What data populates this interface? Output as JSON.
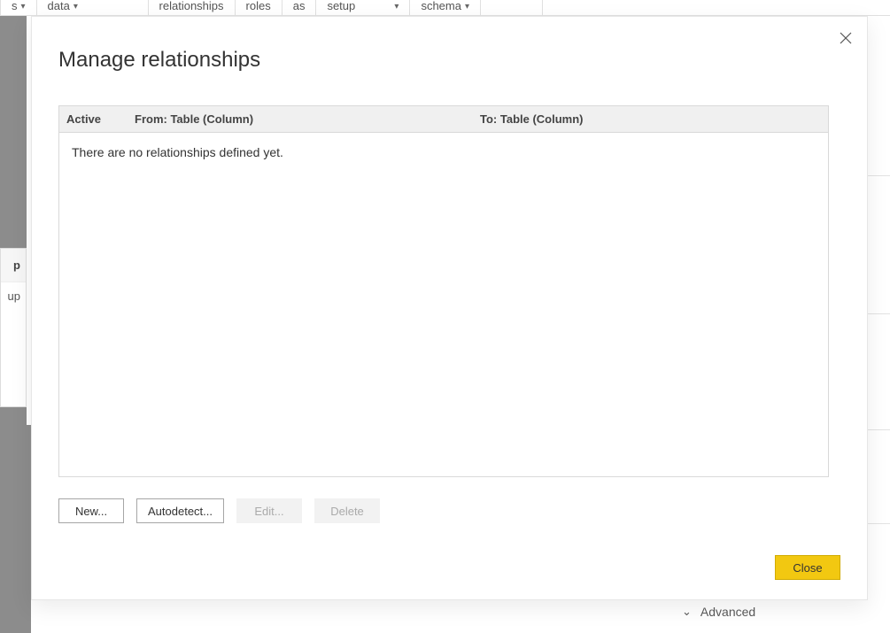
{
  "ribbon": {
    "items": [
      {
        "label": "s",
        "chev": true
      },
      {
        "label": "data",
        "chev": true
      },
      {
        "label": "relationships",
        "chev": false
      },
      {
        "label": "roles",
        "chev": false
      },
      {
        "label": "as",
        "chev": false
      },
      {
        "label": "setup",
        "chev": true,
        "wide": true
      },
      {
        "label": "schema",
        "chev": true
      }
    ]
  },
  "side": {
    "header": "p",
    "row": "up"
  },
  "background": {
    "advanced_label": "Advanced"
  },
  "dialog": {
    "title": "Manage relationships",
    "table": {
      "col_active": "Active",
      "col_from": "From: Table (Column)",
      "col_to": "To: Table (Column)",
      "empty_message": "There are no relationships defined yet."
    },
    "buttons": {
      "new": "New...",
      "autodetect": "Autodetect...",
      "edit": "Edit...",
      "delete": "Delete",
      "close": "Close"
    }
  }
}
